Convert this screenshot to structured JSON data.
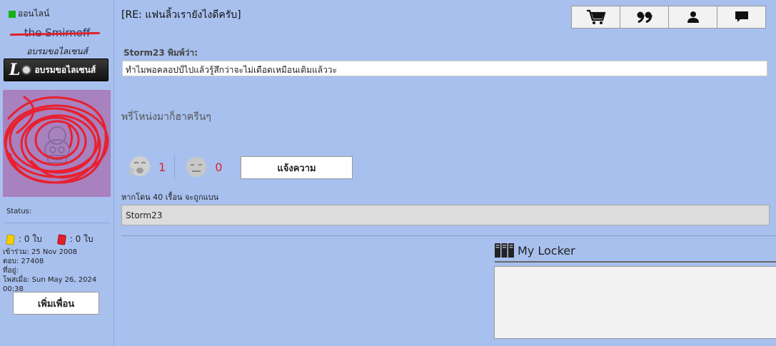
{
  "sidebar": {
    "online_label": "ออนไลน์",
    "username": "the Smirnoff",
    "rank_title": "อบรมขอไลเซนส์",
    "rank_badge": {
      "logo": "L",
      "label": "อบรมขอไลเซนส์"
    },
    "status_label": "Status:",
    "cards": {
      "yellow": ": 0 ใบ",
      "red": ": 0 ใบ"
    },
    "stats": {
      "joined": "เข้าร่วม: 25 Nov 2008",
      "replies": "ตอบ: 27408",
      "location": "ที่อยู่:",
      "posted": "โพสเมื่อ: Sun May 26, 2024 00:38"
    },
    "add_friend_label": "เพิ่มเพื่อน"
  },
  "post": {
    "title": "[RE: แฟนลิ้วเรายังไงดีครับ]",
    "toolbar": [
      "cart-icon",
      "quote-icon",
      "user-icon",
      "message-icon"
    ],
    "quote_author": "Storm23 พิมพ์ว่า:",
    "quote_text": "ทำไมพอคลอปป์ไปแล้วรู้สึกว่าจะไม่เดือดเหมือนเดิมแล้ววะ",
    "message": "พรี่โหน่งมาก็ฮาครีนๆ",
    "reactions": {
      "like_count": "1",
      "dislike_count": "0"
    },
    "report_label": "แจ้งความ",
    "ban_note": "หากโดน 40 เรื้อน จะถูกแบน",
    "signature": "Storm23"
  },
  "locker": {
    "title": "My Locker"
  },
  "colors": {
    "background": "#a8c0ee",
    "online": "#18b018",
    "count": "#e0202a"
  }
}
